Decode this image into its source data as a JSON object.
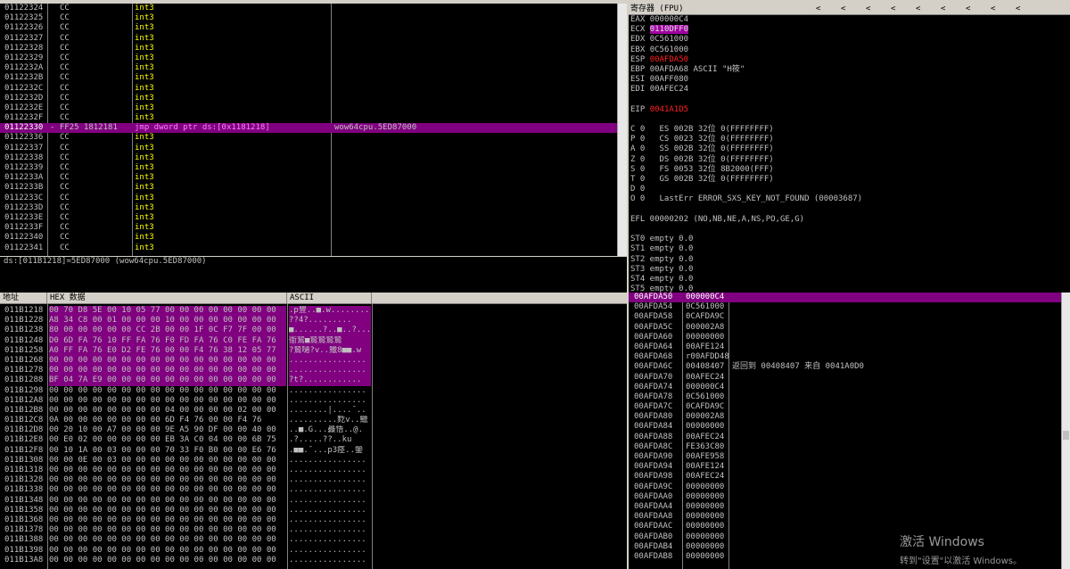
{
  "disasm": {
    "rows": [
      {
        "addr": "01122324",
        "hex": "CC",
        "cmd": "int3",
        "cmt": ""
      },
      {
        "addr": "01122325",
        "hex": "CC",
        "cmd": "int3",
        "cmt": ""
      },
      {
        "addr": "01122326",
        "hex": "CC",
        "cmd": "int3",
        "cmt": ""
      },
      {
        "addr": "01122327",
        "hex": "CC",
        "cmd": "int3",
        "cmt": ""
      },
      {
        "addr": "01122328",
        "hex": "CC",
        "cmd": "int3",
        "cmt": ""
      },
      {
        "addr": "01122329",
        "hex": "CC",
        "cmd": "int3",
        "cmt": ""
      },
      {
        "addr": "0112232A",
        "hex": "CC",
        "cmd": "int3",
        "cmt": ""
      },
      {
        "addr": "0112232B",
        "hex": "CC",
        "cmd": "int3",
        "cmt": ""
      },
      {
        "addr": "0112232C",
        "hex": "CC",
        "cmd": "int3",
        "cmt": ""
      },
      {
        "addr": "0112232D",
        "hex": "CC",
        "cmd": "int3",
        "cmt": ""
      },
      {
        "addr": "0112232E",
        "hex": "CC",
        "cmd": "int3",
        "cmt": ""
      },
      {
        "addr": "0112232F",
        "hex": "CC",
        "cmd": "int3",
        "cmt": ""
      },
      {
        "addr": "01122330",
        "hex": "- FF25 1812181 ",
        "cmd": "jmp dword ptr ds:[0x1181218]",
        "cmt": "wow64cpu.5ED87000",
        "selected": true
      },
      {
        "addr": "01122336",
        "hex": "CC",
        "cmd": "int3",
        "cmt": ""
      },
      {
        "addr": "01122337",
        "hex": "CC",
        "cmd": "int3",
        "cmt": ""
      },
      {
        "addr": "01122338",
        "hex": "CC",
        "cmd": "int3",
        "cmt": ""
      },
      {
        "addr": "01122339",
        "hex": "CC",
        "cmd": "int3",
        "cmt": ""
      },
      {
        "addr": "0112233A",
        "hex": "CC",
        "cmd": "int3",
        "cmt": ""
      },
      {
        "addr": "0112233B",
        "hex": "CC",
        "cmd": "int3",
        "cmt": ""
      },
      {
        "addr": "0112233C",
        "hex": "CC",
        "cmd": "int3",
        "cmt": ""
      },
      {
        "addr": "0112233D",
        "hex": "CC",
        "cmd": "int3",
        "cmt": ""
      },
      {
        "addr": "0112233E",
        "hex": "CC",
        "cmd": "int3",
        "cmt": ""
      },
      {
        "addr": "0112233F",
        "hex": "CC",
        "cmd": "int3",
        "cmt": ""
      },
      {
        "addr": "01122340",
        "hex": "CC",
        "cmd": "int3",
        "cmt": ""
      },
      {
        "addr": "01122341",
        "hex": "CC",
        "cmd": "int3",
        "cmt": ""
      }
    ],
    "info": "ds:[011B1218]=5ED87000 (wow64cpu.5ED87000)"
  },
  "registers": {
    "title": "寄存器 (FPU)",
    "arrows": [
      "<",
      "<",
      "<",
      "<",
      "<",
      "<",
      "<",
      "<",
      "<"
    ],
    "gp": [
      {
        "name": "EAX",
        "value": "000000C4",
        "note": ""
      },
      {
        "name": "ECX",
        "value": "0110DFF0",
        "note": "",
        "style": "pink"
      },
      {
        "name": "EDX",
        "value": "0C561000",
        "note": ""
      },
      {
        "name": "EBX",
        "value": "0C561000",
        "note": ""
      },
      {
        "name": "ESP",
        "value": "00AFDA50",
        "note": "",
        "style": "red"
      },
      {
        "name": "EBP",
        "value": "00AFDA68",
        "note": "ASCII \"H筱\""
      },
      {
        "name": "ESI",
        "value": "00AFF080",
        "note": ""
      },
      {
        "name": "EDI",
        "value": "00AFEC24",
        "note": ""
      }
    ],
    "eip": {
      "name": "EIP",
      "value": "0041A1D5"
    },
    "seg": [
      "C 0   ES 002B 32位 0(FFFFFFFF)",
      "P 0   CS 0023 32位 0(FFFFFFFF)",
      "A 0   SS 002B 32位 0(FFFFFFFF)",
      "Z 0   DS 002B 32位 0(FFFFFFFF)",
      "S 0   FS 0053 32位 8B2000(FFF)",
      "T 0   GS 002B 32位 0(FFFFFFFF)",
      "D 0",
      "O 0   LastErr ERROR_SXS_KEY_NOT_FOUND (00003687)"
    ],
    "efl": "EFL 00000202 (NO,NB,NE,A,NS,PO,GE,G)",
    "fpu": [
      "ST0 empty 0.0",
      "ST1 empty 0.0",
      "ST2 empty 0.0",
      "ST3 empty 0.0",
      "ST4 empty 0.0",
      "ST5 empty 0.0",
      "ST6 empty 0.0",
      "ST7 empty 0.0"
    ]
  },
  "dump": {
    "col_addr": "地址",
    "col_hex": "HEX 数据",
    "col_ascii": "ASCII",
    "rows": [
      {
        "addr": "011B1218",
        "hex": "00 70 D8 5E 00 10 05 77 00 00 00 00 00 00 00 00",
        "ascii": ".p豐..■.w........",
        "hl": true
      },
      {
        "addr": "011B1228",
        "hex": "A8 34 C8 00 01 00 00 00 10 00 00 00 00 00 00 00",
        "ascii": "??4?.........",
        "hl": true
      },
      {
        "addr": "011B1238",
        "hex": "80 00 00 00 00 00 CC 2B 00 00 1F 0C F7 7F 00 00",
        "ascii": "■......?..■..?...",
        "hl": true
      },
      {
        "addr": "011B1248",
        "hex": "D0 6D FA 76 10 FF FA 76 F0 FD FA 76 C0 FE FA 76",
        "ascii": "衜鷙■鷙鷙鷙鷙",
        "hl": true
      },
      {
        "addr": "011B1258",
        "hex": "A0 FF FA 76 E0 D2 FE 76 00 00 F4 76 38 12 05 77",
        "ascii": "?鷙嗵?v..鱲8■■.w",
        "hl": true
      },
      {
        "addr": "011B1268",
        "hex": "00 00 00 00 00 00 00 00 00 00 00 00 00 00 00 00",
        "ascii": "................",
        "hl": true
      },
      {
        "addr": "011B1278",
        "hex": "00 00 00 00 00 00 00 00 00 00 00 00 00 00 00 00",
        "ascii": "................",
        "hl": true
      },
      {
        "addr": "011B1288",
        "hex": "BF 04 7A E9 00 00 00 00 00 00 00 00 00 00 00 00",
        "ascii": "?t?............",
        "hl": true
      },
      {
        "addr": "011B1298",
        "hex": "00 00 00 00 00 00 00 00 00 00 00 00 00 00 00 00",
        "ascii": "................",
        "hl": false
      },
      {
        "addr": "011B12A8",
        "hex": "00 00 00 00 00 00 00 00 00 00 00 00 00 00 00 00",
        "ascii": "................",
        "hl": false
      },
      {
        "addr": "011B12B8",
        "hex": "00 00 00 00 00 00 00 00 04 00 00 00 00 02 00 00",
        "ascii": "........│....¯..",
        "hl": false
      },
      {
        "addr": "011B12C8",
        "hex": "0A 00 00 00 00 00 00 00 6D F4 76 00 00 F4 76",
        "ascii": "..........麧v..鱲",
        "hl": false
      },
      {
        "addr": "011B12D8",
        "hex": "00 20 10 00 A7 00 00 00 9E A5 90 DF 00 00 40 00",
        "ascii": "..■.G...灥悟..@.",
        "hl": false
      },
      {
        "addr": "011B12E8",
        "hex": "00 E0 02 00 00 00 00 00 EB 3A C0 04 00 00 6B 75",
        "ascii": ".?.....??..ku",
        "hl": false
      },
      {
        "addr": "011B12F8",
        "hex": "00 10 1A 00 03 00 00 00 70 33 F0 B0 00 00 E6 76",
        "ascii": ".■■.¯...p3痉..鎣",
        "hl": false
      },
      {
        "addr": "011B1308",
        "hex": "00 00 0E 00 03 00 00 00 00 00 00 00 00 00 00 00",
        "ascii": "................",
        "hl": false
      },
      {
        "addr": "011B1318",
        "hex": "00 00 00 00 00 00 00 00 00 00 00 00 00 00 00 00",
        "ascii": "................",
        "hl": false
      },
      {
        "addr": "011B1328",
        "hex": "00 00 00 00 00 00 00 00 00 00 00 00 00 00 00 00",
        "ascii": "................",
        "hl": false
      },
      {
        "addr": "011B1338",
        "hex": "00 00 00 00 00 00 00 00 00 00 00 00 00 00 00 00",
        "ascii": "................",
        "hl": false
      },
      {
        "addr": "011B1348",
        "hex": "00 00 00 00 00 00 00 00 00 00 00 00 00 00 00 00",
        "ascii": "................",
        "hl": false
      },
      {
        "addr": "011B1358",
        "hex": "00 00 00 00 00 00 00 00 00 00 00 00 00 00 00 00",
        "ascii": "................",
        "hl": false
      },
      {
        "addr": "011B1368",
        "hex": "00 00 00 00 00 00 00 00 00 00 00 00 00 00 00 00",
        "ascii": "................",
        "hl": false
      },
      {
        "addr": "011B1378",
        "hex": "00 00 00 00 00 00 00 00 00 00 00 00 00 00 00 00",
        "ascii": "................",
        "hl": false
      },
      {
        "addr": "011B1388",
        "hex": "00 00 00 00 00 00 00 00 00 00 00 00 00 00 00 00",
        "ascii": "................",
        "hl": false
      },
      {
        "addr": "011B1398",
        "hex": "00 00 00 00 00 00 00 00 00 00 00 00 00 00 00 00",
        "ascii": "................",
        "hl": false
      },
      {
        "addr": "011B13A8",
        "hex": "00 00 00 00 00 00 00 00 00 00 00 00 00 00 00 00",
        "ascii": "................",
        "hl": false
      }
    ]
  },
  "stack": {
    "rows": [
      {
        "addr": "00AFDA50",
        "val": "000000C4",
        "cmt": "",
        "top": true
      },
      {
        "addr": "00AFDA54",
        "val": "0C561000",
        "cmt": ""
      },
      {
        "addr": "00AFDA58",
        "val": "0CAFDA9C",
        "cmt": ""
      },
      {
        "addr": "00AFDA5C",
        "val": "000002A8",
        "cmt": ""
      },
      {
        "addr": "00AFDA60",
        "val": "00000000",
        "cmt": ""
      },
      {
        "addr": "00AFDA64",
        "val": "00AFE124",
        "cmt": ""
      },
      {
        "addr": "00AFDA68",
        "val": "r00AFDD48",
        "cmt": ""
      },
      {
        "addr": "00AFDA6C",
        "val": "00408407",
        "cmt": "返回到 00408407 来自 0041A0D0"
      },
      {
        "addr": "00AFDA70",
        "val": "00AFEC24",
        "cmt": ""
      },
      {
        "addr": "00AFDA74",
        "val": "000000C4",
        "cmt": ""
      },
      {
        "addr": "00AFDA78",
        "val": "0C561000",
        "cmt": ""
      },
      {
        "addr": "00AFDA7C",
        "val": "0CAFDA9C",
        "cmt": ""
      },
      {
        "addr": "00AFDA80",
        "val": "000002A8",
        "cmt": ""
      },
      {
        "addr": "00AFDA84",
        "val": "00000000",
        "cmt": ""
      },
      {
        "addr": "00AFDA88",
        "val": "00AFEC24",
        "cmt": ""
      },
      {
        "addr": "00AFDA8C",
        "val": "FE363C80",
        "cmt": ""
      },
      {
        "addr": "00AFDA90",
        "val": "00AFE958",
        "cmt": ""
      },
      {
        "addr": "00AFDA94",
        "val": "00AFE124",
        "cmt": ""
      },
      {
        "addr": "00AFDA98",
        "val": "00AFEC24",
        "cmt": ""
      },
      {
        "addr": "00AFDA9C",
        "val": "00000000",
        "cmt": ""
      },
      {
        "addr": "00AFDAA0",
        "val": "00000000",
        "cmt": ""
      },
      {
        "addr": "00AFDAA4",
        "val": "00000000",
        "cmt": ""
      },
      {
        "addr": "00AFDAA8",
        "val": "00000000",
        "cmt": ""
      },
      {
        "addr": "00AFDAAC",
        "val": "00000000",
        "cmt": ""
      },
      {
        "addr": "00AFDAB0",
        "val": "00000000",
        "cmt": ""
      },
      {
        "addr": "00AFDAB4",
        "val": "00000000",
        "cmt": ""
      },
      {
        "addr": "00AFDAB8",
        "val": "00000000",
        "cmt": ""
      }
    ]
  },
  "watermark": {
    "line1": "激活 Windows",
    "line2": "转到\"设置\"以激活 Windows。"
  }
}
